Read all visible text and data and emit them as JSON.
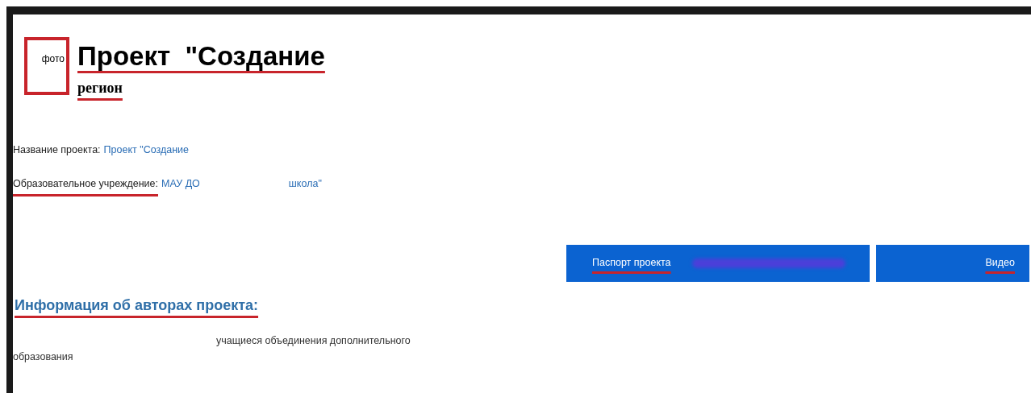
{
  "header": {
    "photo_label": "фото",
    "photo_marked": true,
    "title": "Проект  \"Создание",
    "title_underlined": true,
    "region": "регион",
    "region_underlined": true
  },
  "fields": [
    {
      "label": "Название проекта:",
      "label_underlined": false,
      "values": [
        "Проект \"Создание"
      ]
    },
    {
      "label": "Образовательное учреждение:",
      "label_underlined": true,
      "values": [
        "МАУ ДО",
        "школа\""
      ]
    }
  ],
  "buttons": [
    {
      "label": "Паспорт проекта",
      "underlined": true,
      "redacted": true
    },
    {
      "label": "Видео",
      "underlined": true,
      "redacted": false
    }
  ],
  "authors": {
    "heading": "Информация об авторах проекта:",
    "heading_underlined": true,
    "text": "учащиеся объединения дополнительного образования"
  }
}
